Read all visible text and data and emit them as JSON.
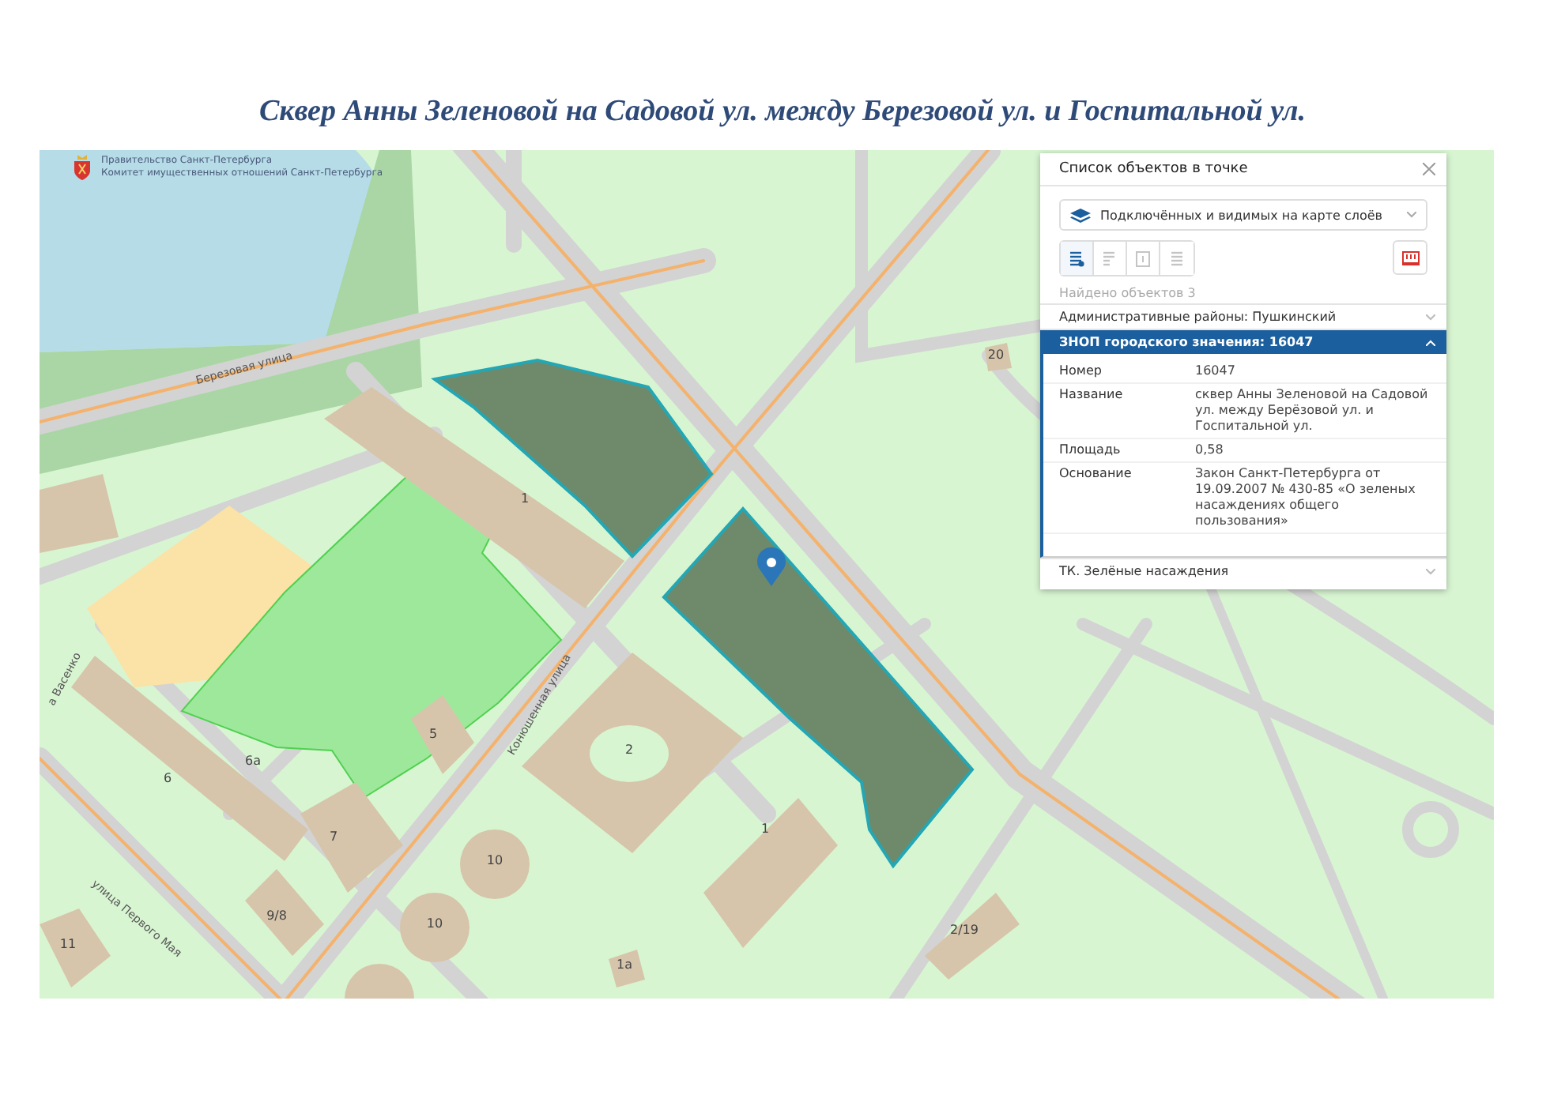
{
  "title": "Сквер Анны Зеленовой на Садовой ул. между Березовой ул. и Госпитальной ул.",
  "map": {
    "logo": {
      "line_1": "Правительство Санкт-Петербурга",
      "line_2": "Комитет имущественных отношений Санкт-Петербурга"
    },
    "labels": [
      {
        "text": "Березовая улица",
        "kind": "street"
      },
      {
        "text": "Конюшенная улица",
        "kind": "street"
      },
      {
        "text": "улица Первого Мая",
        "kind": "street"
      },
      {
        "text": "а Васенко",
        "kind": "street"
      },
      {
        "text": "1",
        "kind": "building"
      },
      {
        "text": "2",
        "kind": "building"
      },
      {
        "text": "1",
        "kind": "building"
      },
      {
        "text": "5",
        "kind": "building"
      },
      {
        "text": "6",
        "kind": "building"
      },
      {
        "text": "6а",
        "kind": "building"
      },
      {
        "text": "7",
        "kind": "building"
      },
      {
        "text": "9/8",
        "kind": "building"
      },
      {
        "text": "10",
        "kind": "building"
      },
      {
        "text": "10",
        "kind": "building"
      },
      {
        "text": "11",
        "kind": "building"
      },
      {
        "text": "1а",
        "kind": "building"
      },
      {
        "text": "2/19",
        "kind": "building"
      },
      {
        "text": "20",
        "kind": "building"
      }
    ]
  },
  "panel": {
    "title": "Список объектов в точке",
    "layer_select": {
      "value": "Подключённых и видимых на карте слоёв"
    },
    "tools": [
      {
        "selected": true
      },
      {
        "selected": false
      },
      {
        "selected": false
      },
      {
        "selected": false
      }
    ],
    "found": "Найдено объектов 3",
    "sections": [
      {
        "title": "Административные районы: Пушкинский",
        "expanded": false
      },
      {
        "title": "ЗНОП городского значения: 16047",
        "expanded": true,
        "rows": [
          {
            "label": "Номер",
            "value": "16047"
          },
          {
            "label": "Название",
            "value": "сквер Анны Зеленовой на Садовой ул. между Берёзовой ул. и Госпитальной ул."
          },
          {
            "label": "Площадь",
            "value": "0,58"
          },
          {
            "label": "Основание",
            "value": "Закон Санкт-Петербурга от 19.09.2007 № 430-85 «О зеленых насаждениях общего пользования»"
          }
        ]
      },
      {
        "title": "ТК. Зелёные насаждения",
        "expanded": false
      }
    ]
  }
}
